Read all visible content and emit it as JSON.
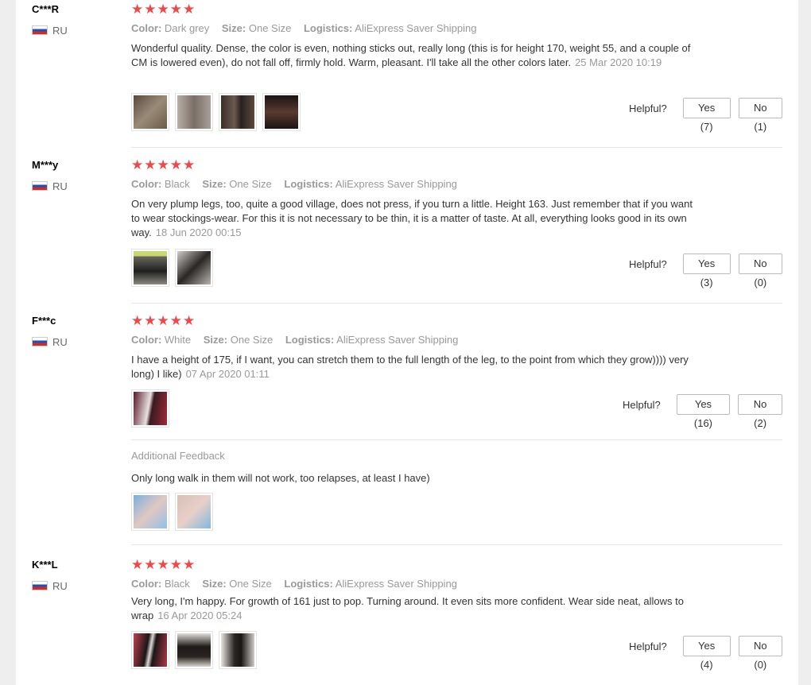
{
  "labels": {
    "color": "Color:",
    "size": "Size:",
    "logistics": "Logistics:",
    "helpful": "Helpful?",
    "additional_feedback": "Additional Feedback"
  },
  "stars_glyph": "★★★★★",
  "reviews": [
    {
      "user": "C***R",
      "country": "RU",
      "rating": 5,
      "color": "Dark grey",
      "size": "One Size",
      "logistics": "AliExpress Saver Shipping",
      "text": "Wonderful quality. Dense, the color is even, nothing sticks out, really long (this is for height 170, weight 55, and a couple of CM is lowered even), do not fall off, firmly hold. Warm, pleasant. I'll take all the other colors later.",
      "date": "25 Mar 2020 10:19",
      "yes": "Yes (7)",
      "no": "No (1)"
    },
    {
      "user": "M***y",
      "country": "RU",
      "rating": 5,
      "color": "Black",
      "size": "One Size",
      "logistics": "AliExpress Saver Shipping",
      "text": "On very plump legs, too, quite a good village, does not press, if you turn a little. Height 163. Just remember that if you want to wear stockings-wear. For this it is not necessary to be thin, it is a matter of taste. At all, everything looks good in its own way.",
      "date": "18 Jun 2020 00:15",
      "yes": "Yes (3)",
      "no": "No (0)"
    },
    {
      "user": "F***c",
      "country": "RU",
      "rating": 5,
      "color": "White",
      "size": "One Size",
      "logistics": "AliExpress Saver Shipping",
      "text": "I have a height of 175, if I want, you can stretch them to the full length of the leg, to the point from which they grow)))) very long) I like)",
      "date": "07 Apr 2020 01:11",
      "yes": "Yes (16)",
      "no": "No (2)",
      "additional_text": "Only long walk in them will not work, too relapses, at least I have)"
    },
    {
      "user": "K***L",
      "country": "RU",
      "rating": 5,
      "color": "Black",
      "size": "One Size",
      "logistics": "AliExpress Saver Shipping",
      "text": "Very long, I'm happy. For growth of 161 just to pop. Turning around. It even sits more confident. Wear side neat, allows to wrap",
      "date": "16 Apr 2020 05:24",
      "yes": "Yes (4)",
      "no": "No (0)"
    }
  ]
}
